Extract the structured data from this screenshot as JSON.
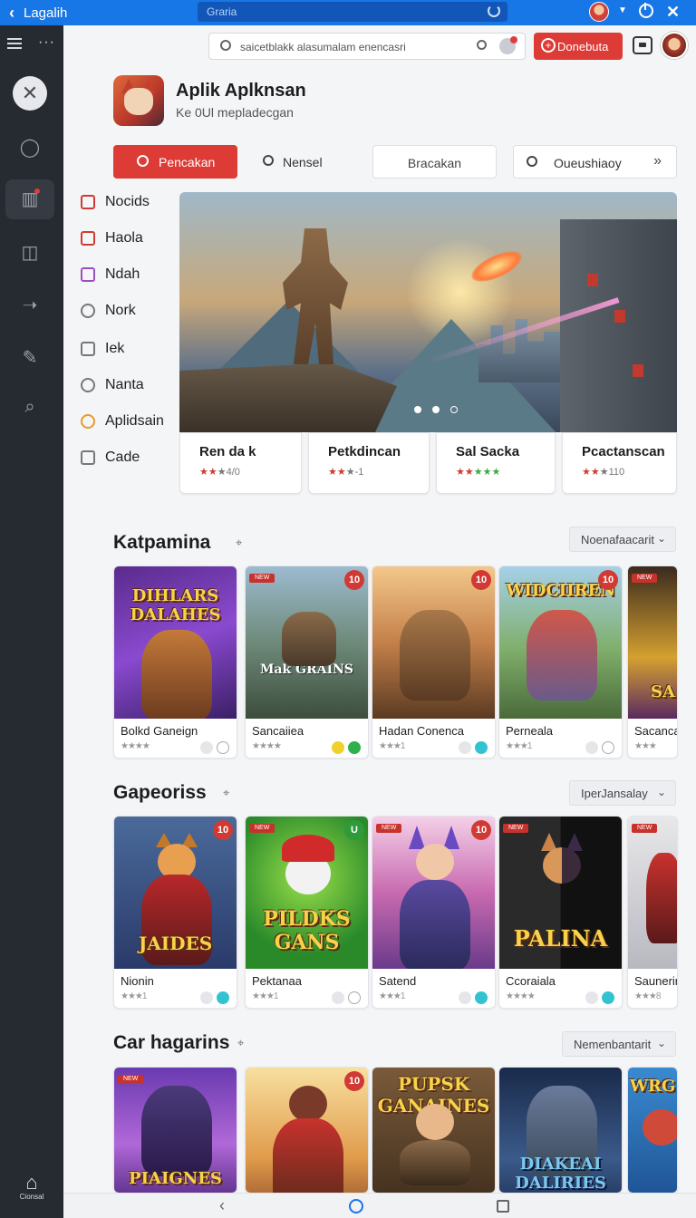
{
  "topbar": {
    "title": "Lagalih",
    "url": "Graria"
  },
  "header": {
    "search_placeholder": "saicetblakk alasumalam enencasri",
    "donate_label": "Donebuta"
  },
  "rail": {
    "home_label": "Cionsal"
  },
  "app": {
    "title": "Aplik Aplknsan",
    "subtitle": "Ke 0Ul mepladecgan"
  },
  "tabs": {
    "primary": "Pencakan",
    "plain": "Nensel",
    "outline": "Bracakan",
    "search": "Oueushiaoy"
  },
  "categories": [
    {
      "label": "Nocids",
      "color": "#d13a34"
    },
    {
      "label": "Haola",
      "color": "#d13a34"
    },
    {
      "label": "Ndah",
      "color": "#9b4fc2"
    },
    {
      "label": "Nork",
      "color": "#777777"
    },
    {
      "label": "Iek",
      "color": "#777777"
    },
    {
      "label": "Nanta",
      "color": "#777777"
    },
    {
      "label": "Aplidsain",
      "color": "#e89a2c"
    },
    {
      "label": "Cade",
      "color": "#777777"
    }
  ],
  "hero_cards": [
    {
      "title": "Ren da k",
      "rating": "4/0"
    },
    {
      "title": "Petkdincan",
      "rating": "-1"
    },
    {
      "title": "Sal Sacka",
      "rating": ""
    },
    {
      "title": "Pcactanscan",
      "rating": "110"
    }
  ],
  "sections": [
    {
      "title": "Katpamina",
      "filter": "Noenafaacarit",
      "games": [
        {
          "name": "Bolkd Ganeign",
          "art_text": "DIHLARS DALAHES",
          "badge": ""
        },
        {
          "name": "Sancaiiea",
          "art_text": "Mak GRAINS",
          "badge": "10"
        },
        {
          "name": "Hadan Conenca",
          "art_text": "",
          "badge": "10"
        },
        {
          "name": "Perneala",
          "art_text": "WIDCIIREN",
          "badge": "10"
        },
        {
          "name": "Sacanca",
          "art_text": "SA",
          "badge": ""
        }
      ]
    },
    {
      "title": "Gapeoriss",
      "filter": "IperJansalay",
      "games": [
        {
          "name": "Nionin",
          "art_text": "JAIDES",
          "badge": "10"
        },
        {
          "name": "Pektanaa",
          "art_text": "PILDKS GANS",
          "badge": "U"
        },
        {
          "name": "Satend",
          "art_text": "",
          "badge": "10"
        },
        {
          "name": "Ccoraiala",
          "art_text": "PALINA",
          "badge": ""
        },
        {
          "name": "Saunerin",
          "art_text": "",
          "badge": ""
        }
      ]
    },
    {
      "title": "Car hagarins",
      "filter": "Nemenbantarit",
      "games": [
        {
          "name": "",
          "art_text": "PIAIGNES",
          "badge": ""
        },
        {
          "name": "",
          "art_text": "",
          "badge": "10"
        },
        {
          "name": "",
          "art_text": "PUPSK GANAINES",
          "badge": ""
        },
        {
          "name": "",
          "art_text": "DIAKEAI DALIRIES",
          "badge": ""
        },
        {
          "name": "",
          "art_text": "WRG",
          "badge": ""
        }
      ]
    }
  ],
  "colors": {
    "brand": "#1877e6",
    "accent": "#dd3b36",
    "rail": "#262a31"
  }
}
